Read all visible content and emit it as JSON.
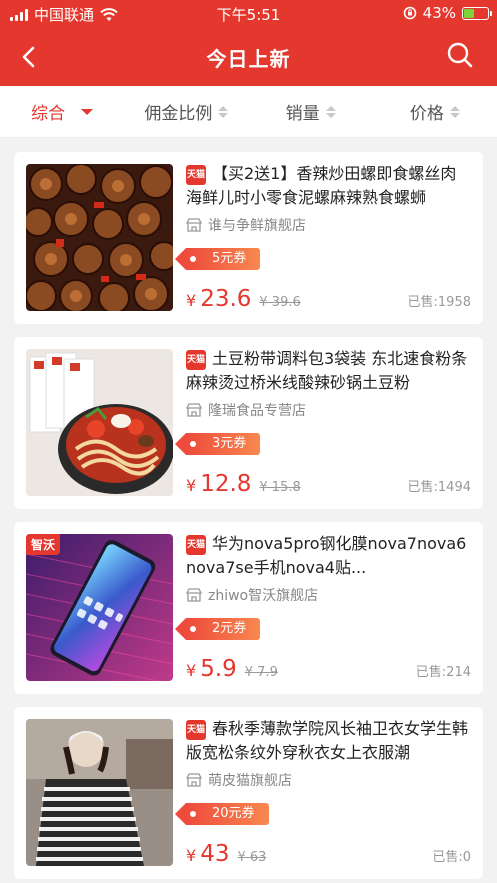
{
  "status_bar": {
    "carrier": "中国联通",
    "time": "下午5:51",
    "battery_text": "43%",
    "battery_level": 0.43
  },
  "nav": {
    "title": "今日上新"
  },
  "sort_tabs": [
    {
      "label": "综合",
      "active": true
    },
    {
      "label": "佣金比例"
    },
    {
      "label": "销量"
    },
    {
      "label": "价格"
    }
  ],
  "products": [
    {
      "platform": "天猫",
      "title": "【买2送1】香辣炒田螺即食螺丝肉海鲜儿时小零食泥螺麻辣熟食螺蛳",
      "shop": "谁与争鲜旗舰店",
      "coupon": "5元券",
      "yen": "¥",
      "price": "23.6",
      "original_price": "¥ 39.6",
      "sold": "已售:1958"
    },
    {
      "platform": "天猫",
      "title": "土豆粉带调料包3袋装 东北速食粉条麻辣烫过桥米线酸辣砂锅土豆粉",
      "shop": "隆瑞食品专营店",
      "coupon": "3元券",
      "yen": "¥",
      "price": "12.8",
      "original_price": "¥ 15.8",
      "sold": "已售:1494"
    },
    {
      "platform": "天猫",
      "title": "华为nova5pro钢化膜nova7nova6nova7se手机nova4贴...",
      "shop": "zhiwo智沃旗舰店",
      "coupon": "2元券",
      "yen": "¥",
      "price": "5.9",
      "original_price": "¥ 7.9",
      "sold": "已售:214",
      "image_tag": "智沃"
    },
    {
      "platform": "天猫",
      "title": "春秋季薄款学院风长袖卫衣女学生韩版宽松条纹外穿秋衣女上衣服潮",
      "shop": "萌皮猫旗舰店",
      "coupon": "20元券",
      "yen": "¥",
      "price": "43",
      "original_price": "¥ 63",
      "sold": "已售:0"
    }
  ],
  "colors": {
    "brand": "#e4382e",
    "price": "#e4382e",
    "muted": "#999999"
  }
}
